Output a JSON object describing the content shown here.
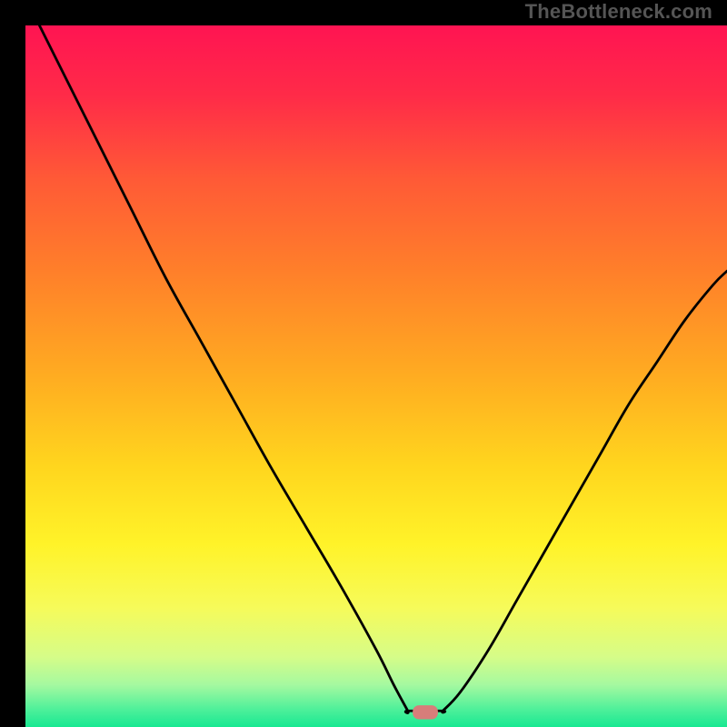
{
  "watermark": "TheBottleneck.com",
  "chart_data": {
    "type": "line",
    "title": "",
    "xlabel": "",
    "ylabel": "",
    "xlim": [
      0,
      100
    ],
    "ylim": [
      0,
      100
    ],
    "series": [
      {
        "name": "left-curve",
        "x": [
          2,
          5,
          10,
          15,
          20,
          25,
          30,
          35,
          40,
          45,
          50,
          52.5,
          54.5
        ],
        "y": [
          100,
          94,
          84,
          74,
          64,
          55,
          46,
          37,
          28.5,
          20,
          11,
          6,
          2.3
        ]
      },
      {
        "name": "floor",
        "x": [
          54.5,
          59.5
        ],
        "y": [
          2.3,
          2.3
        ]
      },
      {
        "name": "right-curve",
        "x": [
          59.5,
          62,
          66,
          70,
          74,
          78,
          82,
          86,
          90,
          94,
          98,
          100
        ],
        "y": [
          2.3,
          5,
          11,
          18,
          25,
          32,
          39,
          46,
          52,
          58,
          63,
          65
        ]
      }
    ],
    "marker": {
      "name": "bottleneck-marker",
      "x": 57,
      "y": 2.1,
      "color": "#d77d7a",
      "width_frac": 0.036,
      "height_frac": 0.02
    },
    "gradient_stops": [
      {
        "offset": 0.0,
        "color": "#ff1452"
      },
      {
        "offset": 0.1,
        "color": "#ff2b48"
      },
      {
        "offset": 0.22,
        "color": "#ff5a36"
      },
      {
        "offset": 0.35,
        "color": "#ff7f2a"
      },
      {
        "offset": 0.5,
        "color": "#ffac21"
      },
      {
        "offset": 0.63,
        "color": "#ffd61e"
      },
      {
        "offset": 0.74,
        "color": "#fff329"
      },
      {
        "offset": 0.83,
        "color": "#f6fb5a"
      },
      {
        "offset": 0.9,
        "color": "#d6fc88"
      },
      {
        "offset": 0.94,
        "color": "#a5f9a0"
      },
      {
        "offset": 0.975,
        "color": "#4ef09a"
      },
      {
        "offset": 1.0,
        "color": "#18e892"
      }
    ]
  }
}
